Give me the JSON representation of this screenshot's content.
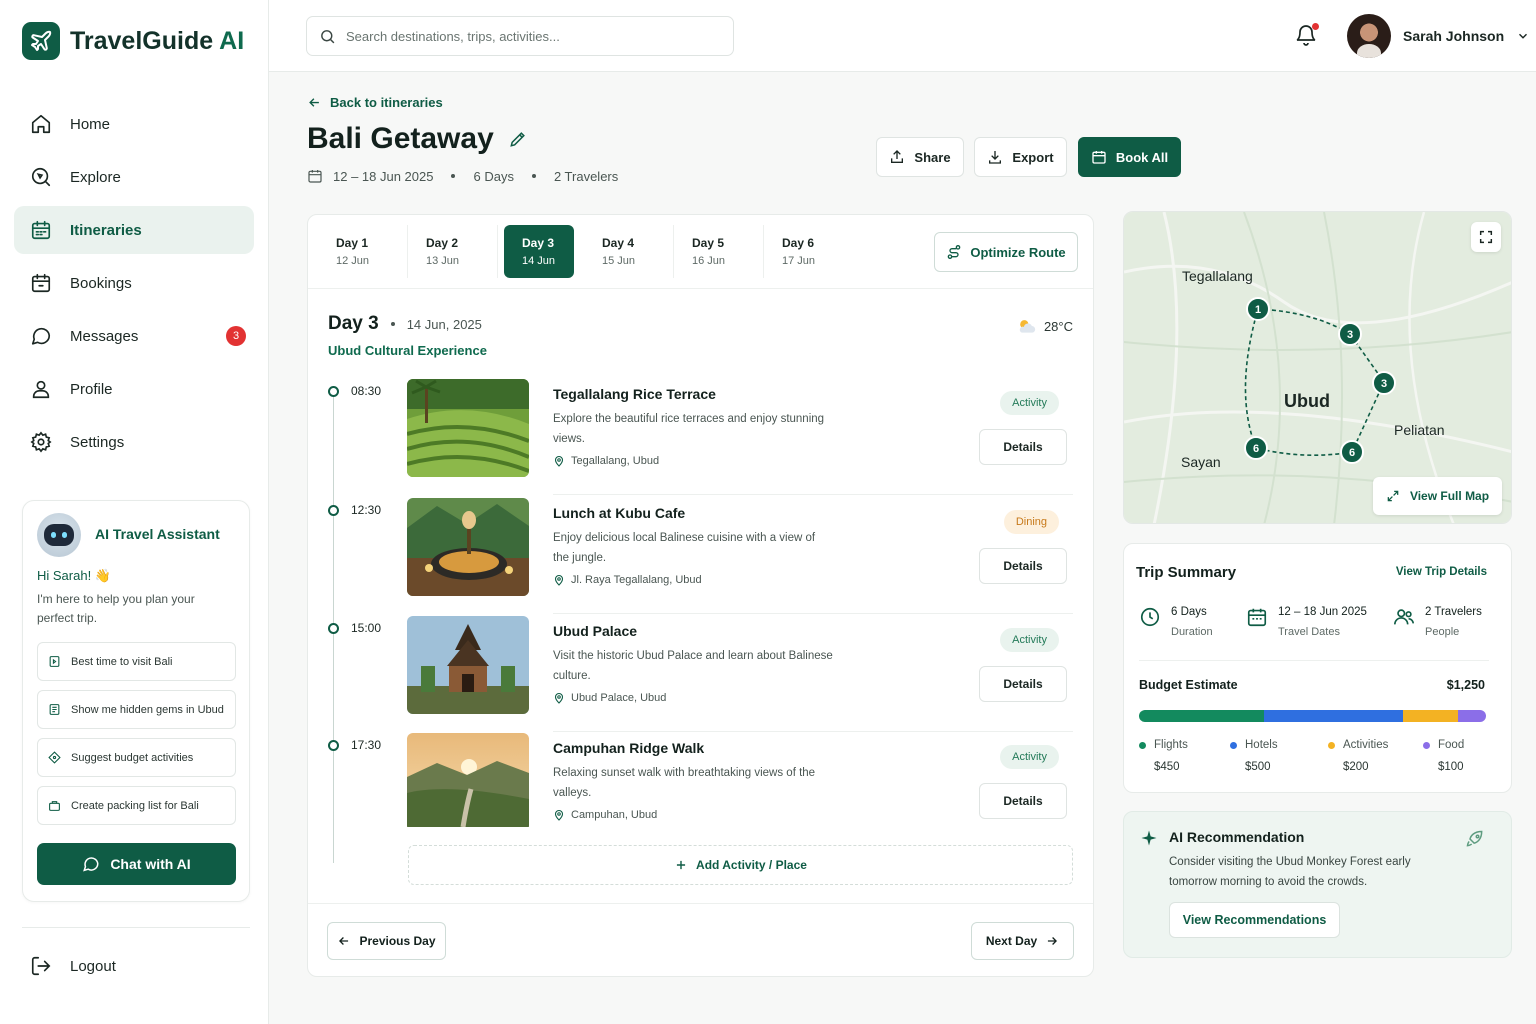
{
  "app": {
    "name": "TravelGuide",
    "name_suffix": "AI"
  },
  "sidebar": {
    "items": [
      {
        "label": "Home",
        "icon": "home-icon"
      },
      {
        "label": "Explore",
        "icon": "search-icon"
      },
      {
        "label": "Itineraries",
        "icon": "calendar-icon",
        "active": true
      },
      {
        "label": "Bookings",
        "icon": "calendar-check-icon"
      },
      {
        "label": "Messages",
        "icon": "chat-bubble-icon",
        "badge": "3"
      },
      {
        "label": "Profile",
        "icon": "user-icon"
      },
      {
        "label": "Settings",
        "icon": "gear-icon"
      }
    ],
    "logout": "Logout"
  },
  "assistant": {
    "title": "AI Travel Assistant",
    "greeting": "Hi Sarah! 👋",
    "intro": "I'm here to help you plan your perfect trip.",
    "suggestions": [
      "Best time to visit Bali",
      "Show me hidden gems in Ubud",
      "Suggest budget activities",
      "Create packing list for Bali"
    ],
    "chat_button": "Chat with AI"
  },
  "header": {
    "search_placeholder": "Search destinations, trips, activities...",
    "user_name": "Sarah Johnson"
  },
  "trip": {
    "back": "Back to itineraries",
    "title": "Bali Getaway",
    "dates": "12 – 18 Jun 2025",
    "days": "6 Days",
    "travelers": "2 Travelers",
    "share": "Share",
    "export": "Export",
    "book_all": "Book All"
  },
  "tabs": [
    {
      "day": "Day 1",
      "date": "12 Jun"
    },
    {
      "day": "Day 2",
      "date": "13 Jun"
    },
    {
      "day": "Day 3",
      "date": "14 Jun",
      "active": true
    },
    {
      "day": "Day 4",
      "date": "15 Jun"
    },
    {
      "day": "Day 5",
      "date": "16 Jun"
    },
    {
      "day": "Day 6",
      "date": "17 Jun"
    }
  ],
  "optimize": "Optimize Route",
  "day": {
    "title": "Day 3",
    "date": "14 Jun, 2025",
    "subtitle": "Ubud Cultural Experience",
    "weather": "28°C"
  },
  "activities": [
    {
      "time": "08:30",
      "title": "Tegallalang Rice Terrace",
      "desc": "Explore the beautiful rice terraces and enjoy stunning views.",
      "location": "Tegallalang, Ubud",
      "tag": "Activity",
      "details": "Details"
    },
    {
      "time": "12:30",
      "title": "Lunch at Kubu Cafe",
      "desc": "Enjoy delicious local Balinese cuisine with a view of the jungle.",
      "location": "Jl. Raya Tegallalang, Ubud",
      "tag": "Dining",
      "details": "Details"
    },
    {
      "time": "15:00",
      "title": "Ubud Palace",
      "desc": "Visit the historic Ubud Palace and learn about Balinese culture.",
      "location": "Ubud Palace, Ubud",
      "tag": "Activity",
      "details": "Details"
    },
    {
      "time": "17:30",
      "title": "Campuhan Ridge Walk",
      "desc": "Relaxing sunset walk with breathtaking views of the valleys.",
      "location": "Campuhan, Ubud",
      "tag": "Activity",
      "details": "Details"
    }
  ],
  "add_activity": "Add Activity / Place",
  "prev_day": "Previous Day",
  "next_day": "Next Day",
  "map": {
    "labels": [
      "Tegallalang",
      "Ubud",
      "Peliatan",
      "Sayan"
    ],
    "markers": [
      "1",
      "3",
      "3",
      "6",
      "6"
    ],
    "view_full": "View Full Map"
  },
  "summary": {
    "title": "Trip Summary",
    "link": "View Trip Details",
    "stats": [
      {
        "value": "6 Days",
        "label": "Duration"
      },
      {
        "value": "12 – 18 Jun 2025",
        "label": "Travel Dates"
      },
      {
        "value": "2 Travelers",
        "label": "People"
      }
    ],
    "budget_label": "Budget Estimate",
    "budget_total": "$1,250",
    "breakdown": [
      {
        "name": "Flights",
        "amount": "$450",
        "value": 450,
        "color": "#138a5e"
      },
      {
        "name": "Hotels",
        "amount": "$500",
        "value": 500,
        "color": "#2f6fe0"
      },
      {
        "name": "Activities",
        "amount": "$200",
        "value": 200,
        "color": "#f3b223"
      },
      {
        "name": "Food",
        "amount": "$100",
        "value": 100,
        "color": "#8b6ee8"
      }
    ]
  },
  "recommendation": {
    "title": "AI Recommendation",
    "text": "Consider visiting the Ubud Monkey Forest early tomorrow morning to avoid the crowds.",
    "button": "View Recommendations"
  }
}
